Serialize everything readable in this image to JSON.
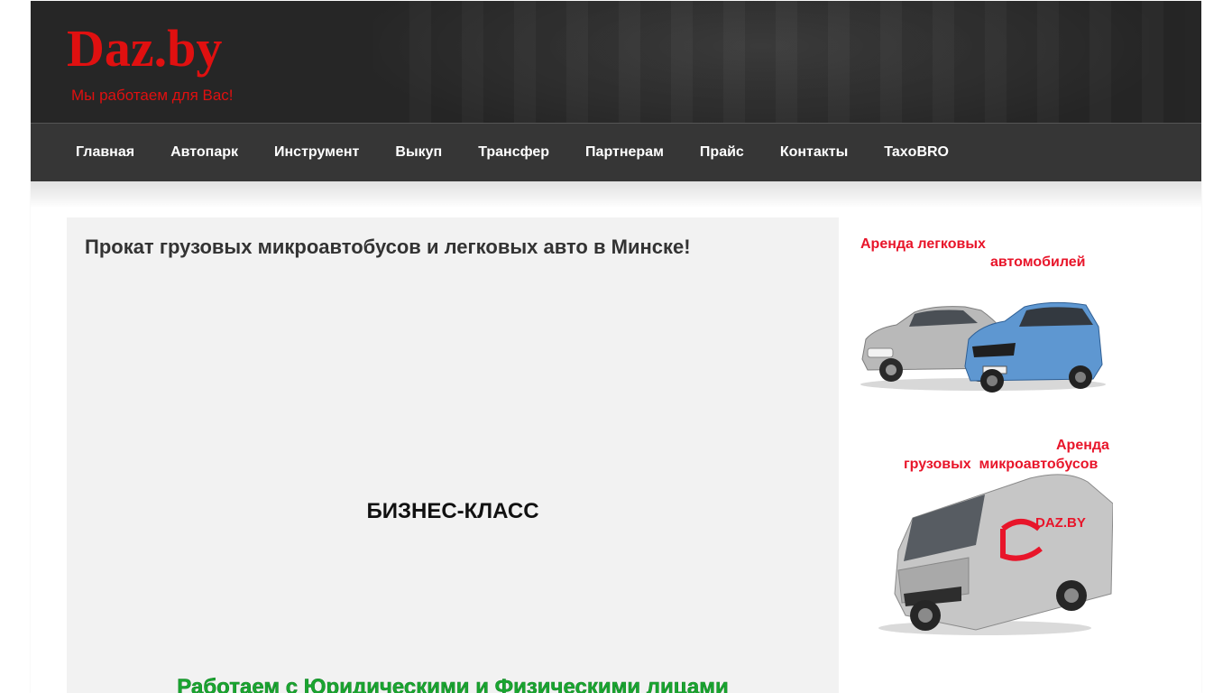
{
  "header": {
    "site_title": "Daz.by",
    "tagline": "Мы работаем для Вас!"
  },
  "nav": {
    "items": [
      {
        "label": "Главная"
      },
      {
        "label": "Автопарк"
      },
      {
        "label": "Инструмент"
      },
      {
        "label": "Выкуп"
      },
      {
        "label": "Трансфер"
      },
      {
        "label": "Партнерам"
      },
      {
        "label": "Прайс"
      },
      {
        "label": "Контакты"
      },
      {
        "label": "TaxoBRO"
      }
    ]
  },
  "main": {
    "title": "Прокат грузовых микроавтобусов и легковых авто в Минске!",
    "business_heading": "БИЗНЕС-КЛАСС",
    "green_line": "Работаем с Юридическими и Физическими лицами"
  },
  "sidebar": {
    "cars_promo": {
      "line1": "Аренда легковых",
      "line2": "автомобилей"
    },
    "van_promo": {
      "line1": "Аренда",
      "line2": "грузовых  микроавтобусов",
      "van_logo": "DAZ.BY"
    }
  },
  "colors": {
    "brand_red": "#e01010",
    "header_bg": "#262626",
    "nav_bg": "#363636",
    "content_bg": "#f2f2f2",
    "green_text": "#1aa630",
    "promo_red": "#e8152a"
  }
}
